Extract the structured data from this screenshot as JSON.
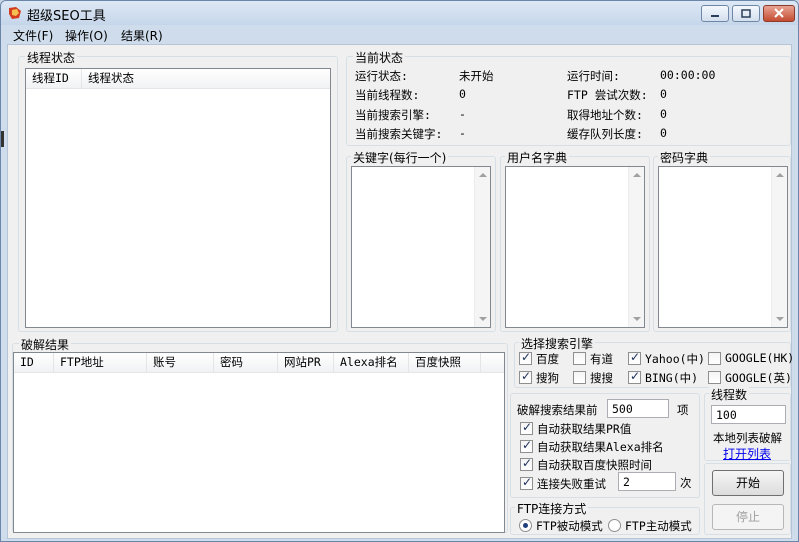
{
  "window": {
    "title": "超级SEO工具"
  },
  "menu": [
    "文件(F)",
    "操作(O)",
    "结果(R)"
  ],
  "thread_status": {
    "group_label": "线程状态",
    "columns": [
      "线程ID",
      "线程状态"
    ]
  },
  "current_status": {
    "group_label": "当前状态",
    "rows": [
      {
        "label": "运行状态:",
        "value": "未开始",
        "label2": "运行时间:",
        "value2": "00:00:00"
      },
      {
        "label": "当前线程数:",
        "value": "0",
        "label2": "FTP 尝试次数:",
        "value2": "0"
      },
      {
        "label": "当前搜索引擎:",
        "value": "-",
        "label2": "取得地址个数:",
        "value2": "0"
      },
      {
        "label": "当前搜索关键字:",
        "value": "-",
        "label2": "缓存队列长度:",
        "value2": "0"
      }
    ]
  },
  "keywords": {
    "label": "关键字(每行一个)"
  },
  "username_dict": {
    "label": "用户名字典"
  },
  "password_dict": {
    "label": "密码字典"
  },
  "results": {
    "group_label": "破解结果",
    "columns": [
      "ID",
      "FTP地址",
      "账号",
      "密码",
      "网站PR",
      "Alexa排名",
      "百度快照"
    ]
  },
  "engines": {
    "group_label": "选择搜索引擎",
    "items": [
      {
        "label": "百度",
        "checked": true
      },
      {
        "label": "有道",
        "checked": false
      },
      {
        "label": "Yahoo(中)",
        "checked": true
      },
      {
        "label": "GOOGLE(HK)",
        "checked": false
      },
      {
        "label": "搜狗",
        "checked": true
      },
      {
        "label": "搜搜",
        "checked": false
      },
      {
        "label": "BING(中)",
        "checked": true
      },
      {
        "label": "GOOGLE(英)",
        "checked": false
      }
    ]
  },
  "crack": {
    "front_label": "破解搜索结果前",
    "front_value": "500",
    "front_unit": "项",
    "options": [
      {
        "label": "自动获取结果PR值",
        "checked": true
      },
      {
        "label": "自动获取结果Alexa排名",
        "checked": true
      },
      {
        "label": "自动获取百度快照时间",
        "checked": true
      },
      {
        "label": "连接失败重试",
        "checked": true
      }
    ],
    "retry_value": "2",
    "retry_unit": "次"
  },
  "threads": {
    "label": "线程数",
    "value": "100"
  },
  "local_list": {
    "label": "本地列表破解",
    "link": "打开列表"
  },
  "buttons": {
    "start": "开始",
    "stop": "停止"
  },
  "ftp_mode": {
    "group_label": "FTP连接方式",
    "options": [
      {
        "label": "FTP被动模式",
        "selected": true
      },
      {
        "label": "FTP主动模式",
        "selected": false
      }
    ]
  }
}
